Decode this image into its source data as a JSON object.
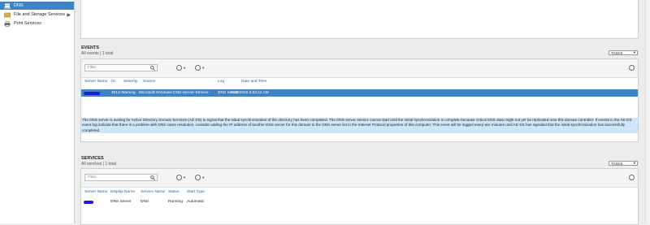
{
  "sidebar": {
    "items": [
      {
        "label": "DNS",
        "icon": "dns-server-icon",
        "active": true
      },
      {
        "label": "File and Storage Services",
        "icon": "file-storage-icon",
        "has_children": true
      },
      {
        "label": "Print Services",
        "icon": "printer-icon"
      }
    ]
  },
  "events": {
    "title": "EVENTS",
    "subtitle": "All events | 1 total",
    "tasks_label": "TASKS",
    "filter_placeholder": "Filter",
    "columns": [
      "Server Name",
      "ID",
      "Severity",
      "Source",
      "Log",
      "Date and Time"
    ],
    "rows": [
      {
        "server_name": "",
        "id": "4013",
        "severity": "Warning",
        "source": "Microsoft-Windows-DNS-Server-Service",
        "log": "DNS Server",
        "date_time": "9/30/2016 5:02:11 AM",
        "selected": true
      }
    ],
    "description": "The DNS server is waiting for Active Directory Domain Services (AD DS) to signal that the initial synchronization of the directory has been completed. The DNS server service cannot start until the initial synchronization is complete because critical DNS data might not yet be replicated onto this domain controller. If events in the AD DS event log indicate that there is a problem with DNS name resolution, consider adding the IP address of another DNS server for this domain to the DNS server list in the Internet Protocol properties of this computer. This event will be logged every two minutes until AD DS has signaled that the initial synchronization has successfully completed."
  },
  "services": {
    "title": "SERVICES",
    "subtitle": "All services | 1 total",
    "tasks_label": "TASKS",
    "filter_placeholder": "Filter",
    "columns": [
      "Server Name",
      "Display Name",
      "Service Name",
      "Status",
      "Start Type"
    ],
    "rows": [
      {
        "server_name": "",
        "display_name": "DNS Server",
        "service_name": "DNS",
        "status": "Running",
        "start_type": "Automatic"
      }
    ]
  },
  "colors": {
    "accent": "#3d83c6",
    "selected_row": "#3d83c6",
    "description_bg": "#cfe5fa",
    "redaction": "#1e1ed8"
  }
}
